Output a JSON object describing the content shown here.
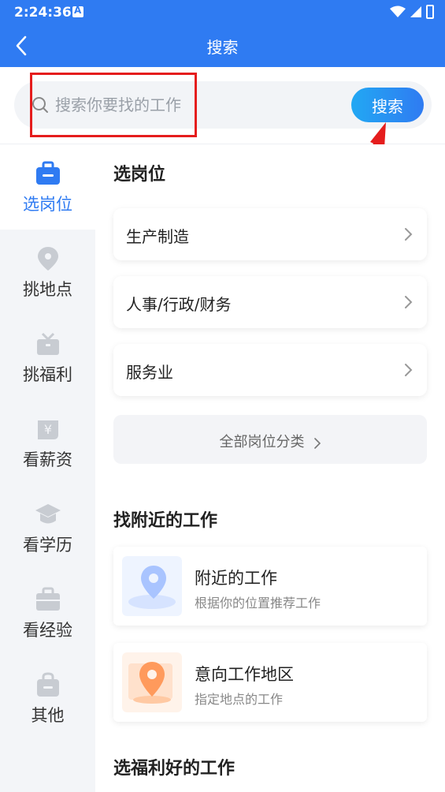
{
  "status_bar": {
    "time": "2:24:36"
  },
  "nav": {
    "title": "搜索"
  },
  "search": {
    "placeholder": "搜索你要找的工作",
    "button_label": "搜索"
  },
  "sidebar": {
    "items": [
      {
        "label": "选岗位",
        "icon": "briefcase-icon",
        "active": true
      },
      {
        "label": "挑地点",
        "icon": "location-pin-icon",
        "active": false
      },
      {
        "label": "挑福利",
        "icon": "gift-icon",
        "active": false
      },
      {
        "label": "看薪资",
        "icon": "yen-icon",
        "active": false
      },
      {
        "label": "看学历",
        "icon": "graduation-cap-icon",
        "active": false
      },
      {
        "label": "看经验",
        "icon": "toolbox-icon",
        "active": false
      },
      {
        "label": "其他",
        "icon": "bag-icon",
        "active": false
      }
    ]
  },
  "main": {
    "section_positions": "选岗位",
    "categories": [
      {
        "label": "生产制造"
      },
      {
        "label": "人事/行政/财务"
      },
      {
        "label": "服务业"
      }
    ],
    "all_categories_label": "全部岗位分类",
    "section_nearby": "找附近的工作",
    "nearby": [
      {
        "title": "附近的工作",
        "subtitle": "根据你的位置推荐工作",
        "icon": "map-location-icon"
      },
      {
        "title": "意向工作地区",
        "subtitle": "指定地点的工作",
        "icon": "map-marker-icon"
      }
    ],
    "section_benefits": "选福利好的工作"
  },
  "colors": {
    "brand": "#2f7bf2",
    "highlight": "#e51d1d"
  }
}
